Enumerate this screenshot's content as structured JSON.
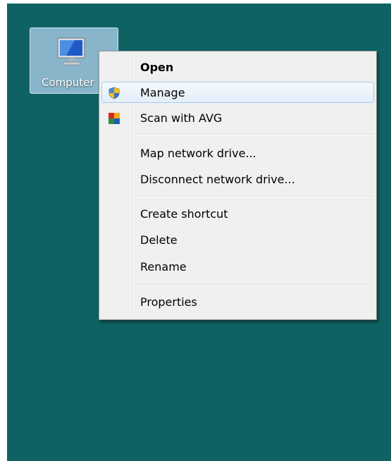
{
  "desktop": {
    "background_color": "#0f6263",
    "icon": {
      "name": "computer-icon",
      "label": "Computer"
    }
  },
  "context_menu": {
    "items": [
      {
        "label": "Open",
        "bold": true
      },
      {
        "label": "Manage",
        "icon": "uac-shield-icon",
        "highlighted": true
      },
      {
        "label": "Scan with AVG",
        "icon": "avg-icon"
      },
      {
        "label": "Map network drive..."
      },
      {
        "label": "Disconnect network drive..."
      },
      {
        "label": "Create shortcut"
      },
      {
        "label": "Delete"
      },
      {
        "label": "Rename"
      },
      {
        "label": "Properties"
      }
    ]
  }
}
